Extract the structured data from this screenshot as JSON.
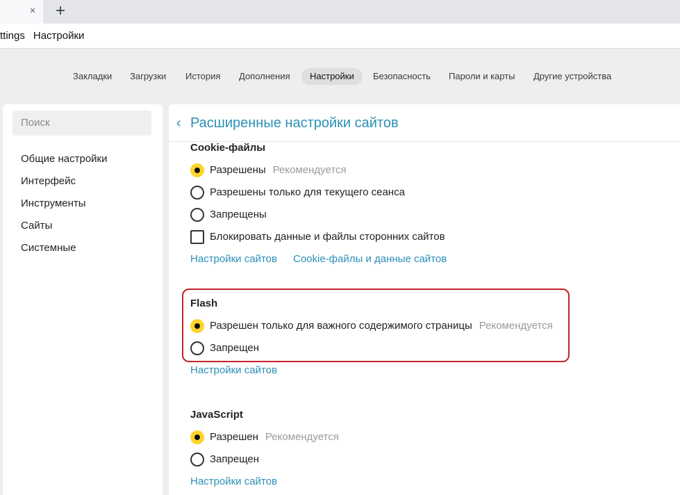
{
  "browser": {
    "tab": {
      "close_glyph": "×"
    },
    "new_tab_glyph": "+",
    "address": {
      "scheme_fragment": "ttings",
      "page": "Настройки"
    }
  },
  "topnav": {
    "items": [
      "Закладки",
      "Загрузки",
      "История",
      "Дополнения",
      "Настройки",
      "Безопасность",
      "Пароли и карты",
      "Другие устройства"
    ],
    "active": "Настройки"
  },
  "sidebar": {
    "search_placeholder": "Поиск",
    "items": [
      "Общие настройки",
      "Интерфейс",
      "Инструменты",
      "Сайты",
      "Системные"
    ]
  },
  "page": {
    "back_glyph": "‹",
    "title": "Расширенные настройки сайтов"
  },
  "cookies": {
    "title": "Cookie-файлы",
    "options": [
      {
        "label": "Разрешены",
        "hint": "Рекомендуется",
        "checked": true
      },
      {
        "label": "Разрешены только для текущего сеанса",
        "hint": "",
        "checked": false
      },
      {
        "label": "Запрещены",
        "hint": "",
        "checked": false
      }
    ],
    "block_third_party": {
      "label": "Блокировать данные и файлы сторонних сайтов",
      "checked": false
    },
    "links": [
      "Настройки сайтов",
      "Cookie-файлы и данные сайтов"
    ]
  },
  "flash": {
    "title": "Flash",
    "options": [
      {
        "label": "Разрешен только для важного содержимого страницы",
        "hint": "Рекомендуется",
        "checked": true
      },
      {
        "label": "Запрещен",
        "hint": "",
        "checked": false
      }
    ],
    "link": "Настройки сайтов"
  },
  "javascript": {
    "title": "JavaScript",
    "options": [
      {
        "label": "Разрешен",
        "hint": "Рекомендуется",
        "checked": true
      },
      {
        "label": "Запрещен",
        "hint": "",
        "checked": false
      }
    ],
    "link": "Настройки сайтов"
  },
  "colors": {
    "accent_link": "#2c8fb7",
    "radio_selected": "#fed42b",
    "highlight_border": "#c4232a"
  }
}
